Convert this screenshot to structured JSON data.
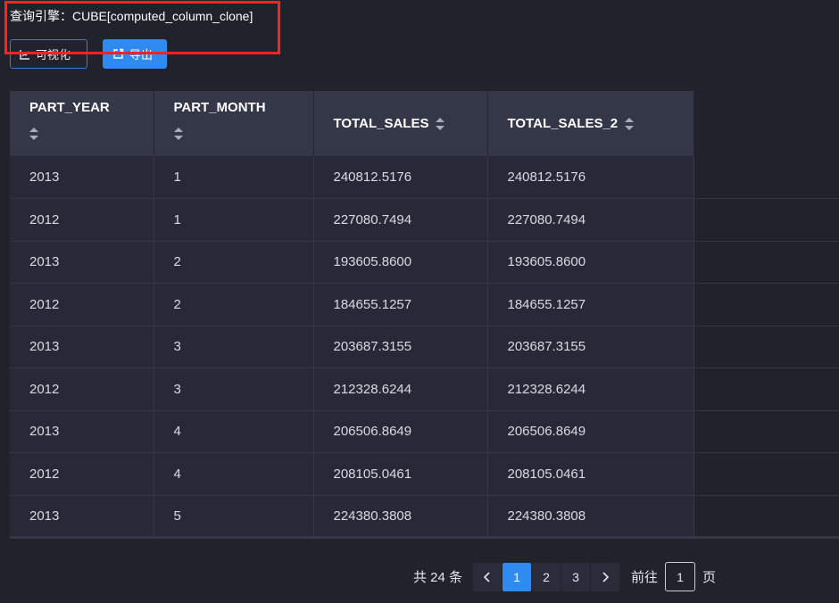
{
  "header": {
    "engine_label": "查询引擎：CUBE[computed_column_clone]"
  },
  "toolbar": {
    "visualize_label": "可视化",
    "export_label": "导出"
  },
  "table": {
    "columns": [
      "PART_YEAR",
      "PART_MONTH",
      "TOTAL_SALES",
      "TOTAL_SALES_2"
    ],
    "rows": [
      [
        "2013",
        "1",
        "240812.5176",
        "240812.5176"
      ],
      [
        "2012",
        "1",
        "227080.7494",
        "227080.7494"
      ],
      [
        "2013",
        "2",
        "193605.8600",
        "193605.8600"
      ],
      [
        "2012",
        "2",
        "184655.1257",
        "184655.1257"
      ],
      [
        "2013",
        "3",
        "203687.3155",
        "203687.3155"
      ],
      [
        "2012",
        "3",
        "212328.6244",
        "212328.6244"
      ],
      [
        "2013",
        "4",
        "206506.8649",
        "206506.8649"
      ],
      [
        "2012",
        "4",
        "208105.0461",
        "208105.0461"
      ],
      [
        "2013",
        "5",
        "224380.3808",
        "224380.3808"
      ]
    ]
  },
  "pagination": {
    "total_text": "共 24 条",
    "pages": [
      "1",
      "2",
      "3"
    ],
    "current_page": "1",
    "goto_prefix": "前往",
    "goto_value": "1",
    "goto_suffix": "页"
  },
  "colors": {
    "accent": "#2f8bf0",
    "highlight": "#ff2222",
    "background": "#20222c"
  }
}
